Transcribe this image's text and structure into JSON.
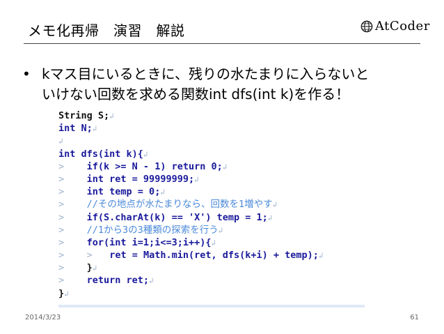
{
  "slide": {
    "title": "メモ化再帰　演習　解説",
    "logo_text": "AtCoder",
    "bullet_marker": "•",
    "bullet_line1": "kマス目にいるときに、残りの水たまりに入らないと",
    "bullet_line2": "いけない回数を求める関数int dfs(int k)を作る！",
    "date": "2014/3/23",
    "page_number": "61"
  },
  "code": {
    "newline_mark": "↲",
    "indent_mark": ">",
    "lines": [
      "String S;",
      "int N;",
      "",
      "int dfs(int k){",
      "if(k >= N - 1) return 0;",
      "int ret = 99999999;",
      "int temp = 0;",
      "//その地点が水たまりなら、回数を1増やす",
      "if(S.charAt(k) == 'X') temp = 1;",
      "//1から3の3種類の探索を行う",
      "for(int i=1;i<=3;i++){",
      "ret = Math.min(ret, dfs(k+i) + temp);",
      "}",
      "return ret;",
      "}"
    ]
  }
}
